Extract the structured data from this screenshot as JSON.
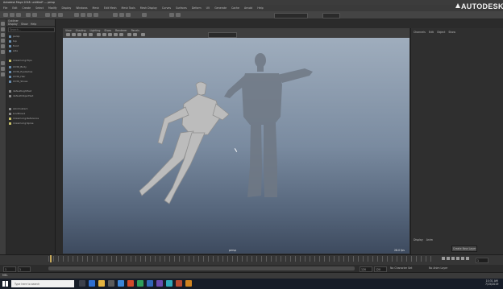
{
  "window": {
    "title": "Autodesk Maya 2018: untitled* --- persp"
  },
  "brand": {
    "logo_text": "AUTODESK"
  },
  "menus": [
    "File",
    "Edit",
    "Create",
    "Select",
    "Modify",
    "Display",
    "Windows",
    "Mesh",
    "Edit Mesh",
    "Mesh Tools",
    "Mesh Display",
    "Curves",
    "Surfaces",
    "Deform",
    "UV",
    "Generate",
    "Cache",
    "Arnold",
    "Help"
  ],
  "viewport": {
    "menus": [
      "View",
      "Shading",
      "Lighting",
      "Show",
      "Renderer",
      "Panels"
    ],
    "camera_label": "persp",
    "fps_label": "28.0 fps"
  },
  "outliner": {
    "title": "Outliner",
    "menus": [
      "Display",
      "Show",
      "Help"
    ],
    "search_placeholder": "Search...",
    "items": [
      "persp",
      "top",
      "front",
      "side",
      "mixamorig:Hips",
      "Ch36_Body",
      "Ch36_Eyelashes",
      "Ch36_Hair",
      "Ch36_Shoes",
      "defaultLightSet",
      "defaultObjectSet",
      "skinCluster1",
      "bindPose1",
      "mixamorig:Reference",
      "mixamorig:Spine"
    ]
  },
  "channel_box": {
    "tabs": [
      "Channels",
      "Edit",
      "Object",
      "Show"
    ],
    "layer_tabs": [
      "Display",
      "Anim"
    ],
    "button_label": "Create New Layer"
  },
  "timeline": {
    "start_value": "1",
    "end_value": "120",
    "current_frame": "1",
    "character_set_label": "No Character Set",
    "anim_layer_label": "No Anim Layer"
  },
  "command_line": {
    "label": "MEL"
  },
  "taskbar": {
    "search_placeholder": "Type here to search",
    "time": "10:31 AM",
    "date": "7/15/2019"
  }
}
